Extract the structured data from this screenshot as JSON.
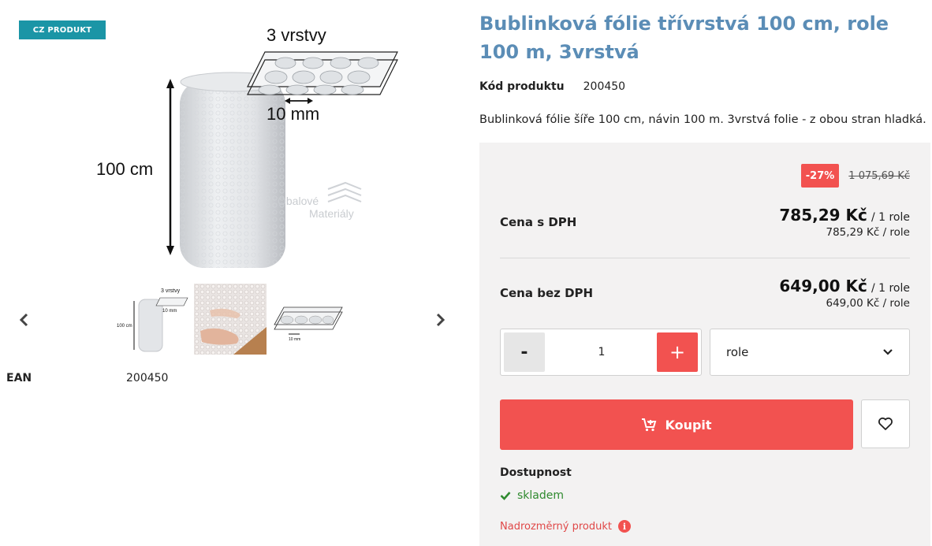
{
  "badge": "CZ PRODUKT",
  "main_image": {
    "label_layers": "3 vrstvy",
    "label_height": "100 cm",
    "label_bubble": "10 mm",
    "watermark_line1": "Obalové",
    "watermark_line2": "Materiály"
  },
  "thumbnails": [
    {
      "icon": "bubble-wrap-roll-diagram",
      "label_layers": "3 vrstvy",
      "label_height": "100 cm",
      "label_bubble": "10 mm"
    },
    {
      "icon": "bubble-wrap-photo"
    },
    {
      "icon": "bubble-layers-diagram",
      "label_bubble": "10 mm"
    }
  ],
  "ean": {
    "label": "EAN",
    "value": "200450"
  },
  "product": {
    "title": "Bublinková fólie třívrstvá 100 cm, role 100 m, 3vrstvá",
    "code_label": "Kód produktu",
    "code_value": "200450",
    "short_description": "Bublinková fólie šíře 100 cm, návin 100 m. 3vrstvá folie - z obou stran hladká."
  },
  "pricing": {
    "discount": "-27%",
    "old_price": "1 075,69 Kč",
    "with_vat": {
      "label": "Cena s DPH",
      "price": "785,29 Kč",
      "unit": "/ 1 role",
      "per_unit": "785,29 Kč / role"
    },
    "without_vat": {
      "label": "Cena bez DPH",
      "price": "649,00 Kč",
      "unit": "/ 1 role",
      "per_unit": "649,00 Kč / role"
    }
  },
  "quantity": {
    "minus": "-",
    "value": "1",
    "plus": "+"
  },
  "unit_select": {
    "selected": "role"
  },
  "buy_button": {
    "label": "Koupit"
  },
  "availability": {
    "label": "Dostupnost",
    "status": "skladem",
    "oversize": "Nadrozměrný produkt",
    "info_glyph": "i"
  },
  "colors": {
    "accent": "#f25250",
    "title": "#5b8db6",
    "badge": "#1b95a6",
    "in_stock": "#2f8a2f"
  }
}
